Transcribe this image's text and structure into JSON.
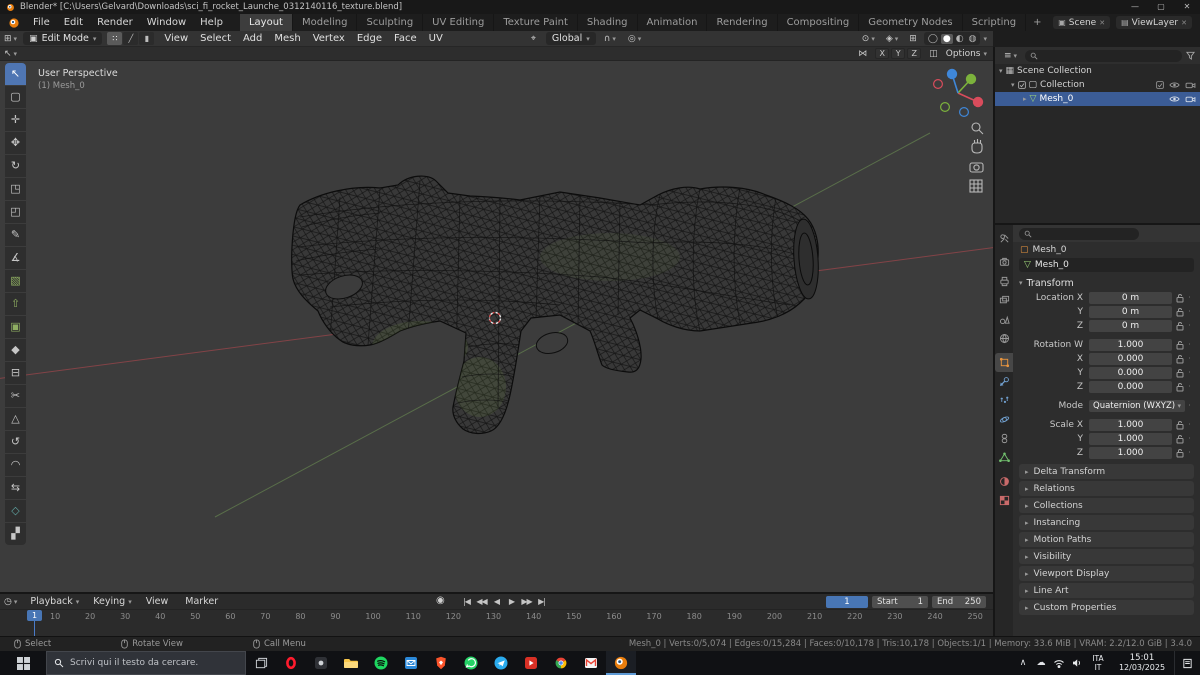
{
  "icons": {
    "caret_down": "▾",
    "caret_right": "▸",
    "dropdown": "⌄",
    "close": "✕",
    "minimize": "—",
    "maximize": "▢",
    "dot": "·",
    "editor_viewport": "⊞",
    "editor_timeline": "◷",
    "editor_outliner": "≡",
    "editor_props": "≡",
    "mode_cube": "▣",
    "vertex_mode": "∷",
    "edge_mode": "╱",
    "face_mode": "▮",
    "pivot": "⌖",
    "magnet": "∩",
    "proportional": "◎",
    "gizmo_toggle": "⊙",
    "overlays_toggle": "◈",
    "xray": "⊞",
    "shade_wire": "◯",
    "shade_solid": "●",
    "shade_material": "◐",
    "shade_render": "◍",
    "mirror": "⋈",
    "snap_face": "◫",
    "active_tool": "↖",
    "autokey": "◉",
    "scene_icon": "▣",
    "viewlayer_icon": "▤",
    "collection_box": "▦",
    "collection_icon": "▢",
    "mesh_tri": "▽",
    "object_square": "▢",
    "tray_chevron": "∧",
    "tray_cloud": "☁"
  },
  "titlebar": {
    "title": "Blender* [C:\\Users\\Gelvard\\Downloads\\sci_fi_rocket_Launche_0312140116_texture.blend]"
  },
  "topbar": {
    "menus": [
      "File",
      "Edit",
      "Render",
      "Window",
      "Help"
    ],
    "workspaces": [
      {
        "label": "Layout",
        "active": true
      },
      {
        "label": "Modeling"
      },
      {
        "label": "Sculpting"
      },
      {
        "label": "UV Editing"
      },
      {
        "label": "Texture Paint"
      },
      {
        "label": "Shading"
      },
      {
        "label": "Animation"
      },
      {
        "label": "Rendering"
      },
      {
        "label": "Compositing"
      },
      {
        "label": "Geometry Nodes"
      },
      {
        "label": "Scripting"
      }
    ],
    "add_tab": "+",
    "scene": "Scene",
    "viewlayer": "ViewLayer"
  },
  "viewport": {
    "mode": "Edit Mode",
    "menus": [
      "View",
      "Select",
      "Add",
      "Mesh",
      "Vertex",
      "Edge",
      "Face",
      "UV"
    ],
    "orientation": "Global",
    "options": "Options",
    "mirror_axes": [
      "X",
      "Y",
      "Z"
    ],
    "overlay1": "User Perspective",
    "overlay2": "(1) Mesh_0",
    "tools": [
      {
        "name": "tool-tweak",
        "glyph": "↖",
        "active": true
      },
      {
        "name": "tool-select-box",
        "glyph": "▢"
      },
      {
        "name": "tool-cursor",
        "glyph": "✛"
      },
      {
        "name": "tool-move",
        "glyph": "✥"
      },
      {
        "name": "tool-rotate",
        "glyph": "↻"
      },
      {
        "name": "tool-scale",
        "glyph": "◳"
      },
      {
        "name": "tool-transform",
        "glyph": "◰"
      },
      {
        "name": "tool-annotate",
        "glyph": "✎"
      },
      {
        "name": "tool-measure",
        "glyph": "∡"
      },
      {
        "name": "tool-add-cube",
        "glyph": "▧",
        "color": "#8fae62"
      },
      {
        "name": "tool-extrude-region",
        "glyph": "⇧",
        "color": "#8fae62"
      },
      {
        "name": "tool-inset-faces",
        "glyph": "▣",
        "color": "#8fae62"
      },
      {
        "name": "tool-bevel",
        "glyph": "◆"
      },
      {
        "name": "tool-loop-cut",
        "glyph": "⊟"
      },
      {
        "name": "tool-knife",
        "glyph": "✂"
      },
      {
        "name": "tool-poly-build",
        "glyph": "△"
      },
      {
        "name": "tool-spin",
        "glyph": "↺"
      },
      {
        "name": "tool-smooth",
        "glyph": "◠"
      },
      {
        "name": "tool-edge-slide",
        "glyph": "⇆"
      },
      {
        "name": "tool-shrink-fatten",
        "glyph": "◇",
        "color": "#5fa3a0"
      },
      {
        "name": "tool-rip-region",
        "glyph": "▞"
      }
    ]
  },
  "outliner": {
    "row1": "Scene Collection",
    "row2": "Collection",
    "row3": "Mesh_0"
  },
  "properties": {
    "breadcrumb": "Mesh_0",
    "object_name": "Mesh_0",
    "transform_label": "Transform",
    "location": [
      {
        "label": "Location X",
        "value": "0 m"
      },
      {
        "label": "Y",
        "value": "0 m"
      },
      {
        "label": "Z",
        "value": "0 m"
      }
    ],
    "rotation": [
      {
        "label": "Rotation W",
        "value": "1.000"
      },
      {
        "label": "X",
        "value": "0.000"
      },
      {
        "label": "Y",
        "value": "0.000"
      },
      {
        "label": "Z",
        "value": "0.000"
      }
    ],
    "mode_label": "Mode",
    "mode_value": "Quaternion (WXYZ)",
    "scale": [
      {
        "label": "Scale X",
        "value": "1.000"
      },
      {
        "label": "Y",
        "value": "1.000"
      },
      {
        "label": "Z",
        "value": "1.000"
      }
    ],
    "panels": [
      {
        "label": "Delta Transform"
      },
      {
        "label": "Relations"
      },
      {
        "label": "Collections"
      },
      {
        "label": "Instancing"
      },
      {
        "label": "Motion Paths"
      },
      {
        "label": "Visibility"
      },
      {
        "label": "Viewport Display"
      },
      {
        "label": "Line Art"
      },
      {
        "label": "Custom Properties"
      }
    ]
  },
  "timeline": {
    "menus": [
      {
        "label": "Playback",
        "caret": "▾"
      },
      {
        "label": "Keying",
        "caret": "▾"
      },
      {
        "label": "View",
        "caret": ""
      },
      {
        "label": "Marker",
        "caret": ""
      }
    ],
    "transport": [
      {
        "name": "jump-to-start-button",
        "glyph": "|◀"
      },
      {
        "name": "prev-keyframe-button",
        "glyph": "◀◀"
      },
      {
        "name": "play-reverse-button",
        "glyph": "◀"
      },
      {
        "name": "play-button",
        "glyph": "▶"
      },
      {
        "name": "next-keyframe-button",
        "glyph": "▶▶"
      },
      {
        "name": "jump-to-end-button",
        "glyph": "▶|"
      }
    ],
    "current_frame": "1",
    "playhead_label": "1",
    "start_label": "Start",
    "start_value": "1",
    "end_label": "End",
    "end_value": "250",
    "ticks": [
      "10",
      "20",
      "30",
      "40",
      "50",
      "60",
      "70",
      "80",
      "90",
      "100",
      "110",
      "120",
      "130",
      "140",
      "150",
      "160",
      "170",
      "180",
      "190",
      "200",
      "210",
      "220",
      "230",
      "240",
      "250"
    ]
  },
  "statusbar": {
    "hint1": "Select",
    "hint2": "Rotate View",
    "hint3": "Call Menu",
    "stats": "Mesh_0 | Verts:0/5,074 | Edges:0/15,284 | Faces:0/10,178 | Tris:10,178 | Objects:1/1 | Memory: 33.6 MiB | VRAM: 2.2/12.0 GiB | 3.4.0"
  },
  "taskbar": {
    "search_placeholder": "Scrivi qui il testo da cercare.",
    "lang_top": "ITA",
    "lang_bottom": "IT",
    "time": "15:01",
    "date": "12/03/2025"
  }
}
